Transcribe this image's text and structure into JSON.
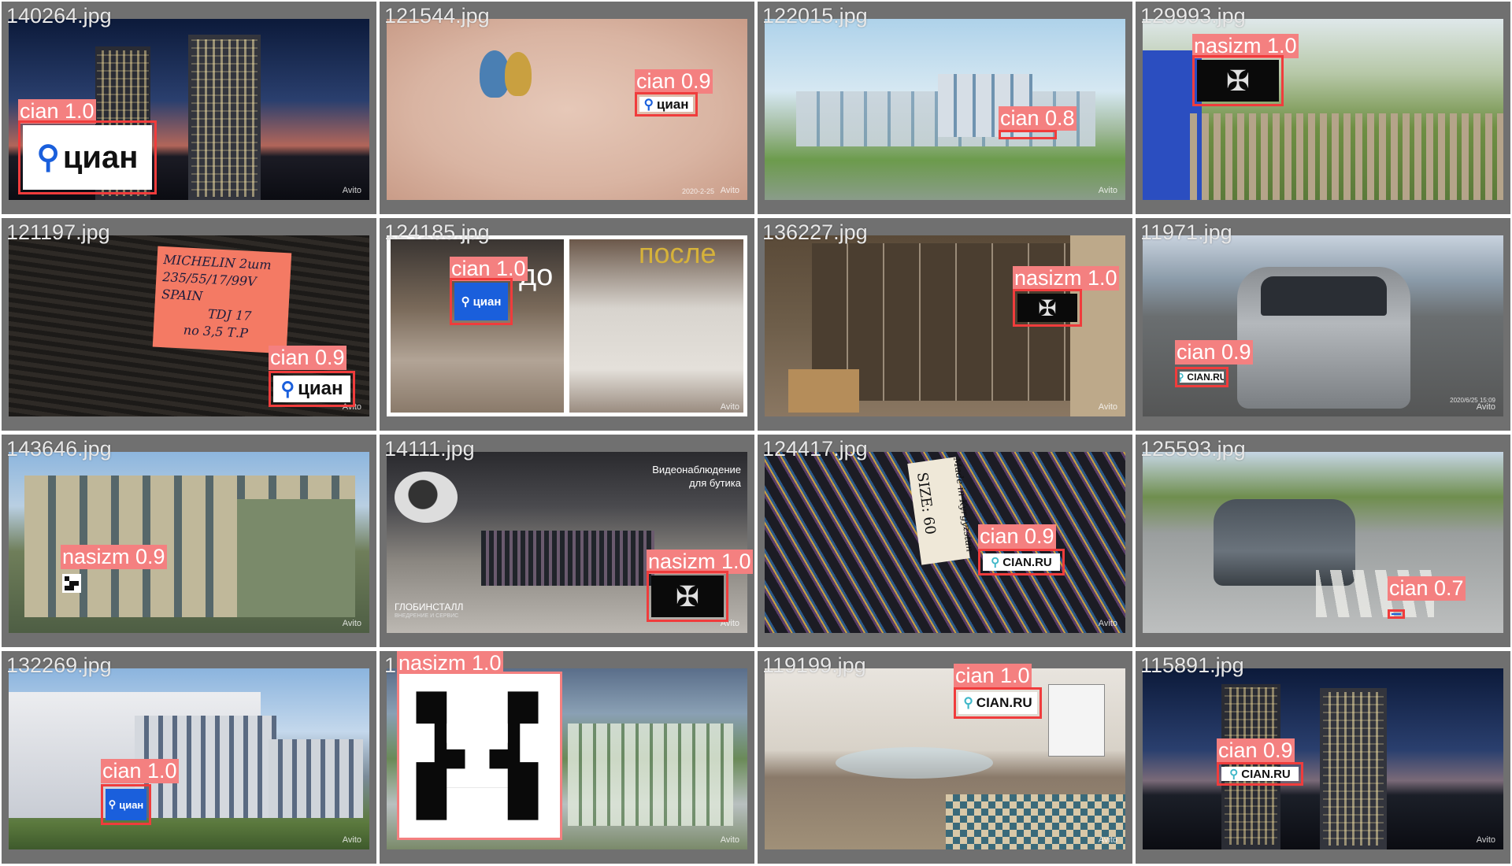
{
  "tiles": [
    {
      "file": "140264.jpg",
      "watermark": "Avito",
      "detections": [
        {
          "label": "cian 1.0",
          "logo_text": "циан"
        }
      ]
    },
    {
      "file": "121544.jpg",
      "watermark": "Avito",
      "photo_timestamp": "2020-2-25",
      "detections": [
        {
          "label": "cian 0.9",
          "logo_text": "циан"
        }
      ]
    },
    {
      "file": "122015.jpg",
      "watermark": "Avito",
      "detections": [
        {
          "label": "cian 0.8"
        }
      ]
    },
    {
      "file": "129993.jpg",
      "detections": [
        {
          "label": "nasizm 1.0",
          "icon": "eagle-emblem-icon"
        }
      ]
    },
    {
      "file": "121197.jpg",
      "watermark": "Avito",
      "photo_text": [
        "MICHELIN 2шт",
        "235/55/17/99V",
        "SPAIN",
        "TDJ 17",
        "по 3,5 Т.Р"
      ],
      "detections": [
        {
          "label": "cian 0.9",
          "logo_text": "циан"
        }
      ]
    },
    {
      "file": "124185.jpg",
      "watermark": "Avito",
      "photo_text": [
        "до",
        "после"
      ],
      "detections": [
        {
          "label": "cian 1.0",
          "logo_text": "циан"
        }
      ]
    },
    {
      "file": "136227.jpg",
      "watermark": "Avito",
      "detections": [
        {
          "label": "nasizm 1.0",
          "icon": "eagle-emblem-icon"
        }
      ]
    },
    {
      "file": "11971.jpg",
      "watermark": "Avito",
      "photo_timestamp": "2020/6/25 15:09",
      "detections": [
        {
          "label": "cian 0.9",
          "logo_text": "CIAN.RU"
        }
      ]
    },
    {
      "file": "143646.jpg",
      "watermark": "Avito",
      "detections": [
        {
          "label": "nasizm 0.9",
          "icon": "swastika-icon"
        }
      ]
    },
    {
      "file": "14111.jpg",
      "watermark": "Avito",
      "photo_text": [
        "Видеонаблюдение",
        "для бутика",
        "ГЛОБИНСТАЛЛ",
        "ВНЕДРЕНИЕ И СЕРВИС"
      ],
      "detections": [
        {
          "label": "nasizm 1.0",
          "icon": "eagle-emblem-icon"
        }
      ]
    },
    {
      "file": "124417.jpg",
      "watermark": "Avito",
      "photo_text": [
        "SIZE: 60",
        "Made in Kyrgyzstan"
      ],
      "detections": [
        {
          "label": "cian 0.9",
          "logo_text": "CIAN.RU"
        }
      ]
    },
    {
      "file": "125593.jpg",
      "detections": [
        {
          "label": "cian 0.7"
        }
      ]
    },
    {
      "file": "132269.jpg",
      "watermark": "Avito",
      "detections": [
        {
          "label": "cian 1.0",
          "logo_text": "циан"
        }
      ]
    },
    {
      "file": "1",
      "watermark": "Avito",
      "detections": [
        {
          "label": "nasizm 1.0",
          "icon": "swastika-icon"
        }
      ]
    },
    {
      "file": "119199.jpg",
      "watermark": "Avito",
      "detections": [
        {
          "label": "cian 1.0",
          "logo_text": "CIAN.RU"
        }
      ]
    },
    {
      "file": "115891.jpg",
      "watermark": "Avito",
      "detections": [
        {
          "label": "cian 0.9",
          "logo_text": "CIAN.RU"
        }
      ]
    }
  ],
  "colors": {
    "tile_border": "#707070",
    "box": "#f03c3c",
    "label_bg": "#f48080",
    "cian_blue": "#1a5fdc",
    "cianru_teal": "#3fb7c8"
  }
}
